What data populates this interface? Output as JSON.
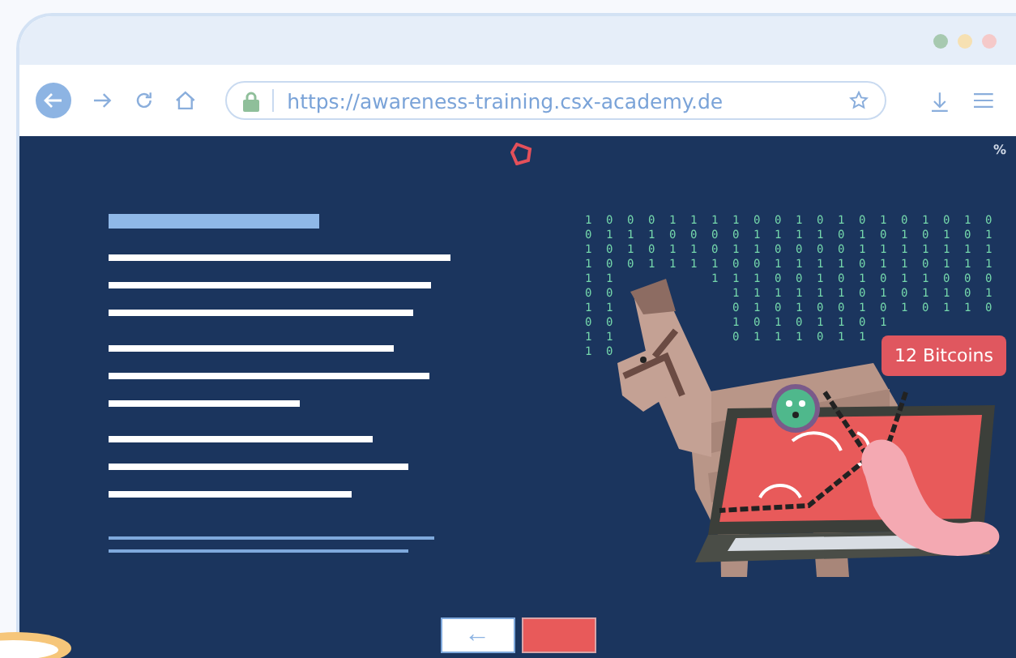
{
  "browser": {
    "url": "https://awareness-training.csx-academy.de"
  },
  "slide": {
    "corner_label": "%",
    "badge": "12 Bitcoins",
    "back_button": "←",
    "binary_columns": [
      "1011101011",
      "0100101010",
      "0110",
      "0101",
      "1011",
      "1011",
      "10011",
      "101011010",
      "011011101",
      "010101011",
      "110101101",
      "010111010",
      "100101011",
      "011010101",
      "10110101",
      "0111101",
      "1010110",
      "0111011",
      "1011001",
      "0111010"
    ]
  }
}
